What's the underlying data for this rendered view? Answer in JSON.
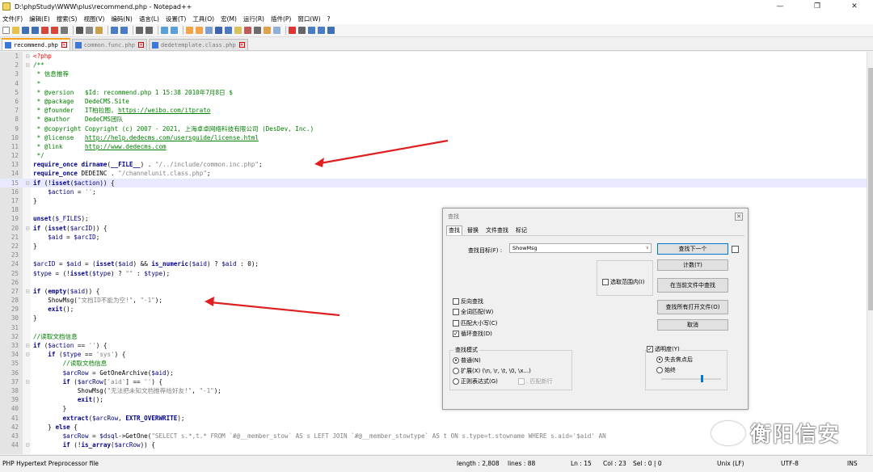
{
  "window": {
    "title": "D:\\phpStudy\\WWW\\plus\\recommend.php - Notepad++",
    "min_glyph": "—",
    "max_glyph": "❐",
    "close_glyph": "✕"
  },
  "menu": [
    "文件(F)",
    "编辑(E)",
    "搜索(S)",
    "视图(V)",
    "编码(N)",
    "语言(L)",
    "设置(T)",
    "工具(O)",
    "宏(M)",
    "运行(R)",
    "插件(P)",
    "窗口(W)",
    "?"
  ],
  "tabs": [
    {
      "label": "recommend.php",
      "active": true
    },
    {
      "label": "common.func.php",
      "active": false
    },
    {
      "label": "dedetemplate.class.php",
      "active": false
    }
  ],
  "editor": {
    "current_line": 15,
    "lines": [
      {
        "n": "1",
        "fold": "⊟",
        "tokens": [
          [
            "php",
            "<?php"
          ]
        ]
      },
      {
        "n": "2",
        "fold": "⊟",
        "tokens": [
          [
            "com",
            "/**"
          ]
        ]
      },
      {
        "n": "3",
        "fold": "",
        "tokens": [
          [
            "com",
            " * 信息推荐"
          ]
        ]
      },
      {
        "n": "4",
        "fold": "",
        "tokens": [
          [
            "com",
            " *"
          ]
        ]
      },
      {
        "n": "5",
        "fold": "",
        "tokens": [
          [
            "com",
            " * @version   $Id: recommend.php 1 15:38 2010年7月8日 $"
          ]
        ]
      },
      {
        "n": "6",
        "fold": "",
        "tokens": [
          [
            "com",
            " * @package   DedeCMS.Site"
          ]
        ]
      },
      {
        "n": "7",
        "fold": "",
        "tokens": [
          [
            "com",
            " * @founder   IT柏拉图, "
          ],
          [
            "link",
            "https://weibo.com/itprato"
          ]
        ]
      },
      {
        "n": "8",
        "fold": "",
        "tokens": [
          [
            "com",
            " * @author    DedeCMS团队"
          ]
        ]
      },
      {
        "n": "9",
        "fold": "",
        "tokens": [
          [
            "com",
            " * @copyright Copyright (c) 2007 - 2021, 上海卓卓网络科技有限公司 (DesDev, Inc.)"
          ]
        ]
      },
      {
        "n": "10",
        "fold": "",
        "tokens": [
          [
            "com",
            " * @license   "
          ],
          [
            "link",
            "http://help.dedecms.com/usersguide/license.html"
          ]
        ]
      },
      {
        "n": "11",
        "fold": "",
        "tokens": [
          [
            "com",
            " * @link      "
          ],
          [
            "link",
            "http://www.dedecms.com"
          ]
        ]
      },
      {
        "n": "12",
        "fold": "",
        "tokens": [
          [
            "com",
            " */"
          ]
        ]
      },
      {
        "n": "13",
        "fold": "",
        "tokens": [
          [
            "kw",
            "require_once"
          ],
          [
            "def",
            " "
          ],
          [
            "kw",
            "dirname"
          ],
          [
            "def",
            "("
          ],
          [
            "kw",
            "__FILE__"
          ],
          [
            "def",
            ") . "
          ],
          [
            "str",
            "\"/../include/common.inc.php\""
          ],
          [
            "def",
            ";"
          ]
        ]
      },
      {
        "n": "14",
        "fold": "",
        "tokens": [
          [
            "kw",
            "require_once"
          ],
          [
            "def",
            " DEDEINC . "
          ],
          [
            "str",
            "\"/channelunit.class.php\""
          ],
          [
            "def",
            ";"
          ]
        ]
      },
      {
        "n": "15",
        "fold": "⊟",
        "tokens": [
          [
            "kw",
            "if"
          ],
          [
            "def",
            " (!"
          ],
          [
            "kw",
            "isset"
          ],
          [
            "def",
            "("
          ],
          [
            "var",
            "$action"
          ],
          [
            "def",
            ")) {"
          ]
        ]
      },
      {
        "n": "16",
        "fold": "",
        "tokens": [
          [
            "var",
            "    $action"
          ],
          [
            "def",
            " = "
          ],
          [
            "str",
            "''"
          ],
          [
            "def",
            ";"
          ]
        ]
      },
      {
        "n": "17",
        "fold": "",
        "tokens": [
          [
            "def",
            "}"
          ]
        ]
      },
      {
        "n": "18",
        "fold": "",
        "tokens": []
      },
      {
        "n": "19",
        "fold": "",
        "tokens": [
          [
            "kw",
            "unset"
          ],
          [
            "def",
            "("
          ],
          [
            "var",
            "$_FILES"
          ],
          [
            "def",
            ");"
          ]
        ]
      },
      {
        "n": "20",
        "fold": "⊟",
        "tokens": [
          [
            "kw",
            "if"
          ],
          [
            "def",
            " ("
          ],
          [
            "kw",
            "isset"
          ],
          [
            "def",
            "("
          ],
          [
            "var",
            "$arcID"
          ],
          [
            "def",
            ")) {"
          ]
        ]
      },
      {
        "n": "21",
        "fold": "",
        "tokens": [
          [
            "var",
            "    $aid"
          ],
          [
            "def",
            " = "
          ],
          [
            "var",
            "$arcID"
          ],
          [
            "def",
            ";"
          ]
        ]
      },
      {
        "n": "22",
        "fold": "",
        "tokens": [
          [
            "def",
            "}"
          ]
        ]
      },
      {
        "n": "23",
        "fold": "",
        "tokens": []
      },
      {
        "n": "24",
        "fold": "",
        "tokens": [
          [
            "var",
            "$arcID"
          ],
          [
            "def",
            " = "
          ],
          [
            "var",
            "$aid"
          ],
          [
            "def",
            " = ("
          ],
          [
            "kw",
            "isset"
          ],
          [
            "def",
            "("
          ],
          [
            "var",
            "$aid"
          ],
          [
            "def",
            ") && "
          ],
          [
            "kw",
            "is_numeric"
          ],
          [
            "def",
            "("
          ],
          [
            "var",
            "$aid"
          ],
          [
            "def",
            ") ? "
          ],
          [
            "var",
            "$aid"
          ],
          [
            "def",
            " : 0);"
          ]
        ]
      },
      {
        "n": "25",
        "fold": "",
        "tokens": [
          [
            "var",
            "$type"
          ],
          [
            "def",
            " = (!"
          ],
          [
            "kw",
            "isset"
          ],
          [
            "def",
            "("
          ],
          [
            "var",
            "$type"
          ],
          [
            "def",
            ") ? "
          ],
          [
            "str",
            "\"\""
          ],
          [
            "def",
            " : "
          ],
          [
            "var",
            "$type"
          ],
          [
            "def",
            ");"
          ]
        ]
      },
      {
        "n": "26",
        "fold": "",
        "tokens": []
      },
      {
        "n": "27",
        "fold": "⊟",
        "tokens": [
          [
            "kw",
            "if"
          ],
          [
            "def",
            " ("
          ],
          [
            "kw",
            "empty"
          ],
          [
            "def",
            "("
          ],
          [
            "var",
            "$aid"
          ],
          [
            "def",
            ")) {"
          ]
        ]
      },
      {
        "n": "28",
        "fold": "",
        "tokens": [
          [
            "def",
            "    ShowMsg("
          ],
          [
            "str",
            "\"文档ID不能为空!\""
          ],
          [
            "def",
            ", "
          ],
          [
            "str",
            "\"-1\""
          ],
          [
            "def",
            ");"
          ]
        ]
      },
      {
        "n": "29",
        "fold": "",
        "tokens": [
          [
            "kw",
            "    exit"
          ],
          [
            "def",
            "();"
          ]
        ]
      },
      {
        "n": "30",
        "fold": "",
        "tokens": [
          [
            "def",
            "}"
          ]
        ]
      },
      {
        "n": "31",
        "fold": "",
        "tokens": []
      },
      {
        "n": "32",
        "fold": "",
        "tokens": [
          [
            "com",
            "//读取文档信息"
          ]
        ]
      },
      {
        "n": "33",
        "fold": "⊟",
        "tokens": [
          [
            "kw",
            "if"
          ],
          [
            "def",
            " ("
          ],
          [
            "var",
            "$action"
          ],
          [
            "def",
            " == "
          ],
          [
            "str",
            "''"
          ],
          [
            "def",
            ") {"
          ]
        ]
      },
      {
        "n": "34",
        "fold": "⊟",
        "tokens": [
          [
            "kw",
            "    if"
          ],
          [
            "def",
            " ("
          ],
          [
            "var",
            "$type"
          ],
          [
            "def",
            " == "
          ],
          [
            "str",
            "'sys'"
          ],
          [
            "def",
            ") {"
          ]
        ]
      },
      {
        "n": "35",
        "fold": "",
        "tokens": [
          [
            "com",
            "        //读取文档信息"
          ]
        ]
      },
      {
        "n": "36",
        "fold": "",
        "tokens": [
          [
            "var",
            "        $arcRow"
          ],
          [
            "def",
            " = GetOneArchive("
          ],
          [
            "var",
            "$aid"
          ],
          [
            "def",
            ");"
          ]
        ]
      },
      {
        "n": "37",
        "fold": "⊟",
        "tokens": [
          [
            "kw",
            "        if"
          ],
          [
            "def",
            " ("
          ],
          [
            "var",
            "$arcRow"
          ],
          [
            "def",
            "["
          ],
          [
            "str",
            "'aid'"
          ],
          [
            "def",
            "] == "
          ],
          [
            "str",
            "''"
          ],
          [
            "def",
            ") {"
          ]
        ]
      },
      {
        "n": "38",
        "fold": "",
        "tokens": [
          [
            "def",
            "            ShowMsg("
          ],
          [
            "str",
            "\"无法把未知文档推荐给好友!\""
          ],
          [
            "def",
            ", "
          ],
          [
            "str",
            "\"-1\""
          ],
          [
            "def",
            ");"
          ]
        ]
      },
      {
        "n": "39",
        "fold": "",
        "tokens": [
          [
            "kw",
            "            exit"
          ],
          [
            "def",
            "();"
          ]
        ]
      },
      {
        "n": "40",
        "fold": "",
        "tokens": [
          [
            "def",
            "        }"
          ]
        ]
      },
      {
        "n": "41",
        "fold": "",
        "tokens": [
          [
            "kw",
            "        extract"
          ],
          [
            "def",
            "("
          ],
          [
            "var",
            "$arcRow"
          ],
          [
            "def",
            ", "
          ],
          [
            "kw",
            "EXTR_OVERWRITE"
          ],
          [
            "def",
            ");"
          ]
        ]
      },
      {
        "n": "42",
        "fold": "",
        "tokens": [
          [
            "def",
            "    } "
          ],
          [
            "kw",
            "else"
          ],
          [
            "def",
            " {"
          ]
        ]
      },
      {
        "n": "43",
        "fold": "",
        "tokens": [
          [
            "var",
            "        $arcRow"
          ],
          [
            "def",
            " = "
          ],
          [
            "var",
            "$dsql"
          ],
          [
            "def",
            "->GetOne("
          ],
          [
            "str",
            "\"SELECT s.*,t.* FROM `#@__member_stow` AS s LEFT JOIN `#@__member_stowtype` AS t ON s.type=t.stowname WHERE s.aid='$aid' AN"
          ]
        ]
      },
      {
        "n": "44",
        "fold": "⊟",
        "tokens": [
          [
            "kw",
            "        if"
          ],
          [
            "def",
            " (!"
          ],
          [
            "kw",
            "is_array"
          ],
          [
            "def",
            "("
          ],
          [
            "var",
            "$arcRow"
          ],
          [
            "def",
            ")) {"
          ]
        ]
      }
    ]
  },
  "find_dialog": {
    "title": "查找",
    "close_glyph": "✕",
    "tabs": [
      "查找",
      "替换",
      "文件查找",
      "标记"
    ],
    "find_label": "查找目标(F) :",
    "find_value": "ShowMsg",
    "buttons": {
      "find_next": "查找下一个",
      "count": "计数(T)",
      "find_in_current": "在当前文件中查找",
      "find_in_all_open": "查找所有打开文件(O)",
      "cancel": "取消"
    },
    "in_selection": "选取范围内(I)",
    "checkboxes": [
      {
        "label": "反向查找",
        "checked": false
      },
      {
        "label": "全词匹配(W)",
        "checked": false
      },
      {
        "label": "匹配大小写(C)",
        "checked": false
      },
      {
        "label": "循环查找(D)",
        "checked": true
      }
    ],
    "search_mode": {
      "title": "查找模式",
      "options": [
        "普通(N)",
        "扩展(X) (\\n, \\r, \\t, \\0, \\x...)",
        "正则表达式(G)"
      ],
      "selected": 0,
      "dot_newline": ". 匹配新行"
    },
    "transparency": {
      "title": "透明度(Y)",
      "checked": true,
      "options": [
        "失去焦点后",
        "始终"
      ],
      "selected": 0,
      "level": 0.66
    }
  },
  "status": {
    "file_type": "PHP Hypertext Preprocessor file",
    "length": "length : 2,808",
    "lines": "lines : 88",
    "ln": "Ln : 15",
    "col": "Col : 23",
    "sel": "Sel : 0 | 0",
    "eol": "Unix (LF)",
    "encoding": "UTF-8",
    "mode": "INS"
  },
  "watermark": "衡阳信安",
  "colors": {
    "comment": "#008000",
    "keyword": "#00008b",
    "string": "#808080",
    "annotation_arrow": "#e02020",
    "current_line": "#e8e8ff"
  }
}
